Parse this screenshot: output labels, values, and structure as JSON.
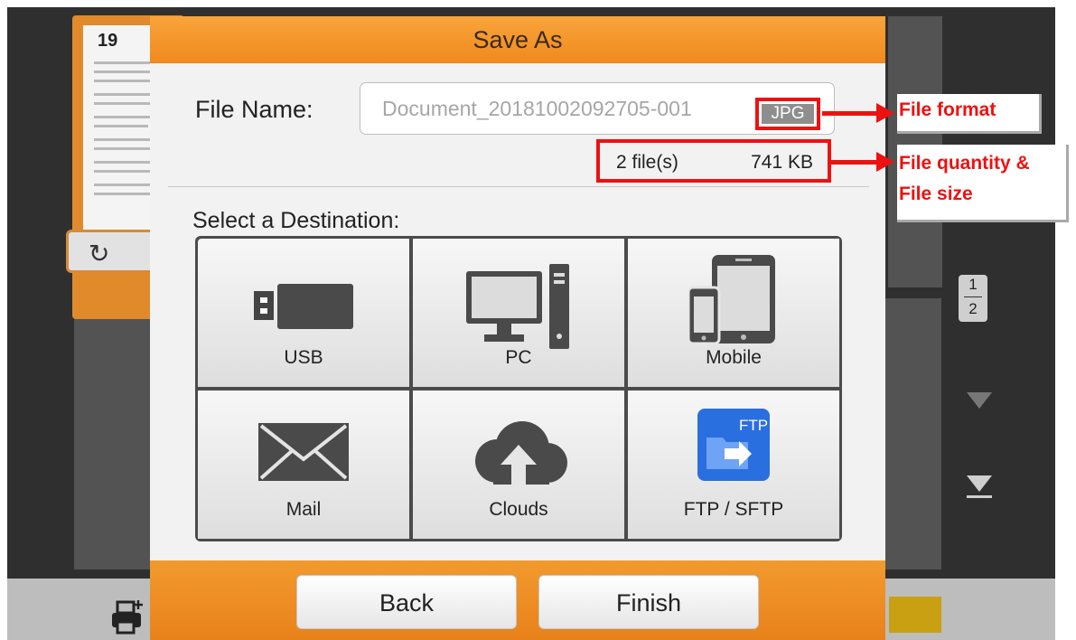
{
  "background": {
    "thumbnail_page_number": "19",
    "page_indicator": {
      "current": "1",
      "total": "2"
    },
    "icons": {
      "rotate": "rotate-icon",
      "scroll_down": "scroll-down-icon",
      "scroll_end": "scroll-end-icon",
      "printer_add": "printer-add-icon"
    }
  },
  "dialog": {
    "title": "Save As",
    "file_name_label": "File Name:",
    "file_name_value": "Document_20181002092705-001",
    "file_format": "JPG",
    "file_count": "2 file(s)",
    "file_size": "741 KB",
    "destination_label": "Select a Destination:",
    "destinations": [
      {
        "label": "USB",
        "icon": "usb-icon"
      },
      {
        "label": "PC",
        "icon": "pc-icon"
      },
      {
        "label": "Mobile",
        "icon": "mobile-icon"
      },
      {
        "label": "Mail",
        "icon": "mail-icon"
      },
      {
        "label": "Clouds",
        "icon": "cloud-upload-icon"
      },
      {
        "label": "FTP / SFTP",
        "icon": "ftp-icon",
        "icon_text": "FTP"
      }
    ],
    "buttons": {
      "back": "Back",
      "finish": "Finish"
    }
  },
  "annotations": {
    "file_format": "File format",
    "file_quantity_line1": "File quantity &",
    "file_quantity_line2": "File size"
  },
  "colors": {
    "accent_orange": "#f29a2e",
    "callout_red": "#ee1111",
    "ftp_blue": "#2a6fe0"
  }
}
